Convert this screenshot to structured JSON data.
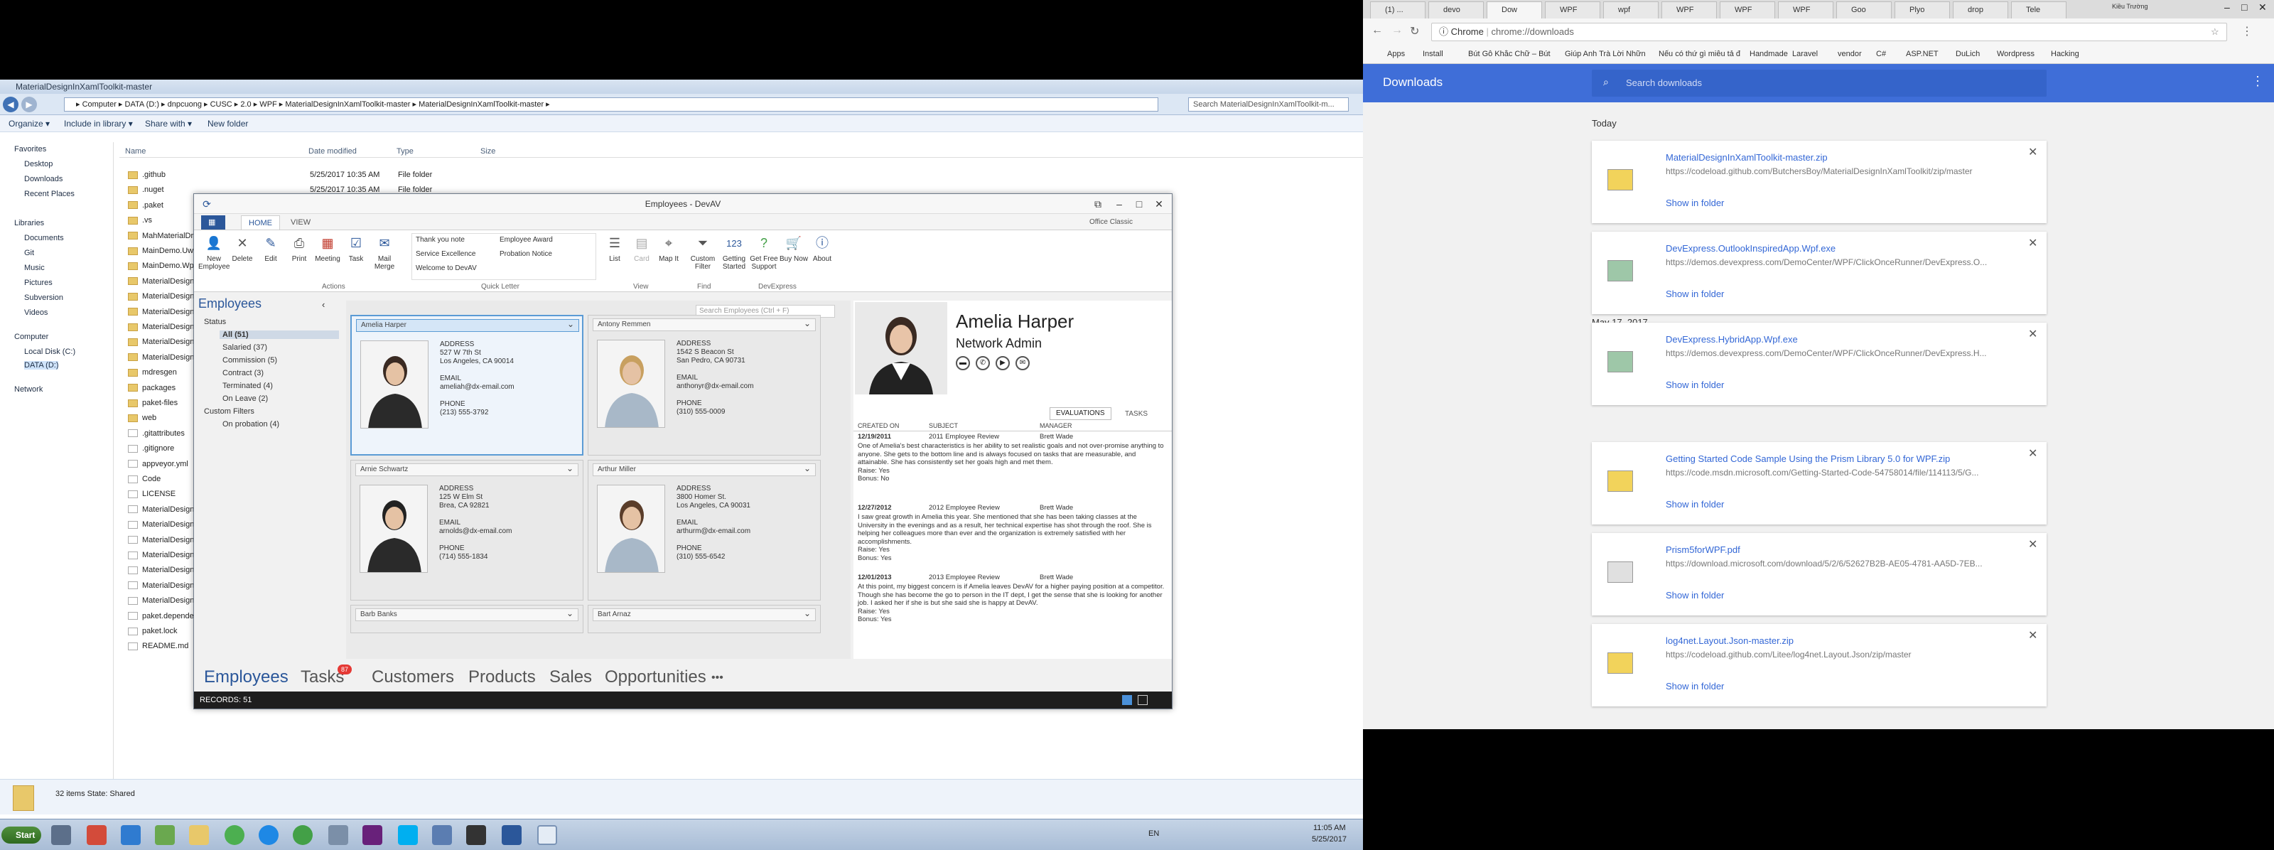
{
  "explorer": {
    "title": "MaterialDesignInXamlToolkit-master",
    "path": "▸ Computer ▸ DATA (D:) ▸ dnpcuong ▸ CUSC ▸ 2.0 ▸ WPF ▸ MaterialDesignInXamlToolkit-master ▸ MaterialDesignInXamlToolkit-master ▸",
    "search": "Search MaterialDesignInXamlToolkit-m...",
    "toolbar": [
      "Organize ▾",
      "Include in library ▾",
      "Share with ▾",
      "New folder"
    ],
    "sidebar": [
      "Favorites",
      "Desktop",
      "Downloads",
      "Recent Places",
      "Libraries",
      "Documents",
      "Git",
      "Music",
      "Pictures",
      "Subversion",
      "Videos",
      "Computer",
      "Local Disk (C:)",
      "DATA (D:)",
      "Network"
    ],
    "columns": [
      "Name",
      "Date modified",
      "Type",
      "Size"
    ],
    "files": [
      {
        "name": ".github",
        "date": "5/25/2017 10:35 AM",
        "type": "File folder",
        "kind": "folder"
      },
      {
        "name": ".nuget",
        "date": "5/25/2017 10:35 AM",
        "type": "File folder",
        "kind": "folder"
      },
      {
        "name": ".paket",
        "date": "",
        "type": "",
        "kind": "folder"
      },
      {
        "name": ".vs",
        "date": "",
        "type": "",
        "kind": "folder"
      },
      {
        "name": "MahMaterialDra",
        "date": "",
        "type": "",
        "kind": "folder"
      },
      {
        "name": "MainDemo.Uwp",
        "date": "",
        "type": "",
        "kind": "folder"
      },
      {
        "name": "MainDemo.Wpf",
        "date": "",
        "type": "",
        "kind": "folder"
      },
      {
        "name": "MaterialDesignC",
        "date": "",
        "type": "",
        "kind": "folder"
      },
      {
        "name": "MaterialDesignC",
        "date": "",
        "type": "",
        "kind": "folder"
      },
      {
        "name": "MaterialDesignT",
        "date": "",
        "type": "",
        "kind": "folder"
      },
      {
        "name": "MaterialDesignT",
        "date": "",
        "type": "",
        "kind": "folder"
      },
      {
        "name": "MaterialDesignT",
        "date": "",
        "type": "",
        "kind": "folder"
      },
      {
        "name": "MaterialDesignT",
        "date": "",
        "type": "",
        "kind": "folder"
      },
      {
        "name": "mdresgen",
        "date": "",
        "type": "",
        "kind": "folder"
      },
      {
        "name": "packages",
        "date": "",
        "type": "",
        "kind": "folder"
      },
      {
        "name": "paket-files",
        "date": "",
        "type": "",
        "kind": "folder"
      },
      {
        "name": "web",
        "date": "",
        "type": "",
        "kind": "folder"
      },
      {
        "name": ".gitattributes",
        "date": "",
        "type": "",
        "kind": "doc"
      },
      {
        "name": ".gitignore",
        "date": "",
        "type": "",
        "kind": "doc"
      },
      {
        "name": "appveyor.yml",
        "date": "",
        "type": "",
        "kind": "doc"
      },
      {
        "name": "Code",
        "date": "",
        "type": "",
        "kind": "doc"
      },
      {
        "name": "LICENSE",
        "date": "",
        "type": "",
        "kind": "doc"
      },
      {
        "name": "MaterialDesignC",
        "date": "",
        "type": "",
        "kind": "doc"
      },
      {
        "name": "MaterialDesignT",
        "date": "",
        "type": "",
        "kind": "doc"
      },
      {
        "name": "MaterialDesignT",
        "date": "",
        "type": "",
        "kind": "doc"
      },
      {
        "name": "MaterialDesignT",
        "date": "",
        "type": "",
        "kind": "doc"
      },
      {
        "name": "MaterialDesignT",
        "date": "",
        "type": "",
        "kind": "doc"
      },
      {
        "name": "MaterialDesignT",
        "date": "",
        "type": "",
        "kind": "doc"
      },
      {
        "name": "MaterialDesignT",
        "date": "",
        "type": "",
        "kind": "doc"
      },
      {
        "name": "paket.depender",
        "date": "",
        "type": "",
        "kind": "doc"
      },
      {
        "name": "paket.lock",
        "date": "",
        "type": "",
        "kind": "doc"
      },
      {
        "name": "README.md",
        "date": "",
        "type": "",
        "kind": "doc"
      }
    ],
    "status": "32 items  State:  Shared"
  },
  "taskbar": {
    "start": "Start",
    "lang": "EN",
    "time": "11:05 AM",
    "date": "5/25/2017"
  },
  "devav": {
    "title": "Employees - DevAV",
    "theme": "Office Classic",
    "tabs": [
      "HOME",
      "VIEW"
    ],
    "ribbon": {
      "actions": [
        "New Employee",
        "Delete",
        "Edit",
        "Print",
        "Meeting",
        "Task",
        "Mail Merge"
      ],
      "quick_letters": [
        "Thank you note",
        "Employee Award",
        "Service Excellence",
        "Probation Notice",
        "Welcome to DevAV"
      ],
      "view": [
        "List",
        "Card",
        "Map It"
      ],
      "find": [
        "Custom Filter"
      ],
      "devexpress": [
        "Getting Started",
        "Get Free Support",
        "Buy Now",
        "About"
      ],
      "groups": [
        "Actions",
        "Quick Letter",
        "View",
        "Find",
        "DevExpress"
      ]
    },
    "nav": {
      "title": "Employees",
      "status_label": "Status",
      "status_items": [
        "All (51)",
        "Salaried (37)",
        "Commission (5)",
        "Contract (3)",
        "Terminated (4)",
        "On Leave (2)"
      ],
      "custom_label": "Custom Filters",
      "custom_items": [
        "On probation  (4)"
      ]
    },
    "search_placeholder": "Search Employees (Ctrl + F)",
    "cards": [
      {
        "name": "Amelia Harper",
        "addr1": "527 W 7th St",
        "addr2": "Los Angeles, CA 90014",
        "email": "ameliah@dx-email.com",
        "phone": "(213) 555-3792"
      },
      {
        "name": "Antony Remmen",
        "addr1": "1542 S Beacon St",
        "addr2": "San Pedro, CA 90731",
        "email": "anthonyr@dx-email.com",
        "phone": "(310) 555-0009"
      },
      {
        "name": "Arnie Schwartz",
        "addr1": "125 W Elm St",
        "addr2": "Brea, CA 92821",
        "email": "arnolds@dx-email.com",
        "phone": "(714) 555-1834"
      },
      {
        "name": "Arthur Miller",
        "addr1": "3800 Homer St.",
        "addr2": "Los Angeles, CA 90031",
        "email": "arthurm@dx-email.com",
        "phone": "(310) 555-6542"
      },
      {
        "name": "Barb Banks"
      },
      {
        "name": "Bart Arnaz"
      }
    ],
    "card_labels": {
      "address": "ADDRESS",
      "email": "EMAIL",
      "phone": "PHONE"
    },
    "detail": {
      "name": "Amelia Harper",
      "role": "Network Admin",
      "tabs": [
        "EVALUATIONS",
        "TASKS"
      ],
      "columns": [
        "CREATED ON",
        "SUBJECT",
        "MANAGER"
      ],
      "evals": [
        {
          "date": "12/19/2011",
          "subject": "2011 Employee Review",
          "manager": "Brett Wade",
          "text": "One of Amelia's best characteristics is her ability to set realistic goals and not over-promise anything to anyone. She gets to the bottom line and is always focused on tasks that are measurable, and attainable. She has consistently set her goals high and met them.",
          "raise": "Raise: Yes",
          "bonus": "Bonus: No"
        },
        {
          "date": "12/27/2012",
          "subject": "2012 Employee Review",
          "manager": "Brett Wade",
          "text": "I saw great growth in Amelia this year. She mentioned that she has been taking classes at the University in the evenings and as a result, her technical expertise has shot through the roof. She is helping her colleagues more than ever and the organization is extremely satisfied with her accomplishments.",
          "raise": "Raise: Yes",
          "bonus": "Bonus: Yes"
        },
        {
          "date": "12/01/2013",
          "subject": "2013 Employee Review",
          "manager": "Brett Wade",
          "text": "At this point, my biggest concern is if Amelia leaves DevAV for a higher paying position at a competitor. Though she has become the go to person in the IT dept, I get the sense that she is looking for another job. I asked her if she is but she said she is happy at DevAV.",
          "raise": "Raise: Yes",
          "bonus": "Bonus: Yes"
        }
      ]
    },
    "bottom_nav": [
      "Employees",
      "Tasks",
      "Customers",
      "Products",
      "Sales",
      "Opportunities",
      "•••"
    ],
    "tasks_badge": "87",
    "records": "RECORDS: 51"
  },
  "chrome": {
    "tabs": [
      "(1) ...",
      "devo",
      "Dow",
      "WPF",
      "wpf",
      "WPF",
      "WPF",
      "WPF",
      "Goo",
      "Plyo",
      "drop",
      "Tele"
    ],
    "profile": "Kiều Trường",
    "url_prefix": "Chrome",
    "url": "chrome://downloads",
    "bookmarks": [
      "Apps",
      "Install",
      "Bút Gỗ Khắc Chữ – Bút",
      "Giúp Anh Trà Lời Nhữn",
      "Nếu có thứ gì miễu tả đ",
      "Handmade",
      "Laravel",
      "vendor",
      "C#",
      "ASP.NET",
      "DuLich",
      "Wordpress",
      "Hacking"
    ],
    "page_title": "Downloads",
    "search_placeholder": "Search downloads",
    "today": "Today",
    "earlier": "May 17, 2017",
    "show_in_folder": "Show in folder",
    "downloads": [
      {
        "file": "MaterialDesignInXamlToolkit-master.zip",
        "url": "https://codeload.github.com/ButchersBoy/MaterialDesignInXamlToolkit/zip/master",
        "icon": "zip-icon"
      },
      {
        "file": "DevExpress.OutlookInspiredApp.Wpf.exe",
        "url": "https://demos.devexpress.com/DemoCenter/WPF/ClickOnceRunner/DevExpress.O...",
        "icon": "exe-icon"
      },
      {
        "file": "DevExpress.HybridApp.Wpf.exe",
        "url": "https://demos.devexpress.com/DemoCenter/WPF/ClickOnceRunner/DevExpress.H...",
        "icon": "exe-icon"
      },
      {
        "file": "Getting Started Code Sample Using the Prism Library 5.0 for WPF.zip",
        "url": "https://code.msdn.microsoft.com/Getting-Started-Code-54758014/file/114113/5/G...",
        "icon": "zip-icon"
      },
      {
        "file": "Prism5forWPF.pdf",
        "url": "https://download.microsoft.com/download/5/2/6/52627B2B-AE05-4781-AA5D-7EB...",
        "icon": "pdf-icon"
      },
      {
        "file": "log4net.Layout.Json-master.zip",
        "url": "https://codeload.github.com/Litee/log4net.Layout.Json/zip/master",
        "icon": "zip-icon"
      }
    ]
  },
  "colors": {
    "chrome_blue": "#3f6ed8",
    "devav_blue": "#2b579a",
    "link": "#3367d6"
  }
}
